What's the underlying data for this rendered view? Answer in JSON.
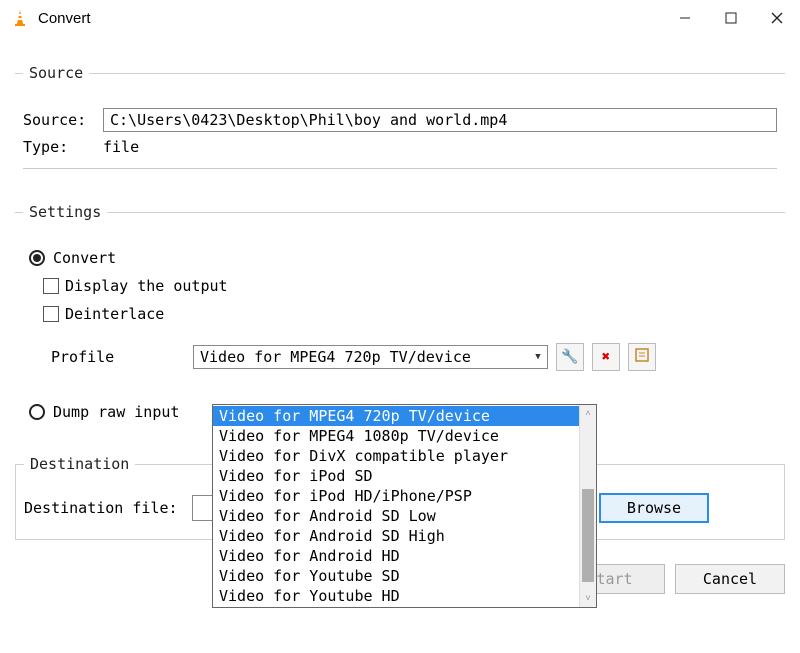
{
  "titlebar": {
    "title": "Convert"
  },
  "source": {
    "legend": "Source",
    "source_label": "Source:",
    "source_value": "C:\\Users\\0423\\Desktop\\Phil\\boy and world.mp4",
    "type_label": "Type:",
    "type_value": "file"
  },
  "settings": {
    "legend": "Settings",
    "convert_label": "Convert",
    "display_output_label": "Display the output",
    "deinterlace_label": "Deinterlace",
    "profile_label": "Profile",
    "profile_selected": "Video for MPEG4 720p TV/device",
    "dump_raw_label": "Dump raw input",
    "options": [
      "Video for MPEG4 720p TV/device",
      "Video for MPEG4 1080p TV/device",
      "Video for DivX compatible player",
      "Video for iPod SD",
      "Video for iPod HD/iPhone/PSP",
      "Video for Android SD Low",
      "Video for Android SD High",
      "Video for Android HD",
      "Video for Youtube SD",
      "Video for Youtube HD"
    ]
  },
  "destination": {
    "legend": "Destination",
    "file_label": "Destination file:",
    "file_value": "",
    "browse_label": "Browse"
  },
  "buttons": {
    "start": "Start",
    "cancel": "Cancel"
  }
}
